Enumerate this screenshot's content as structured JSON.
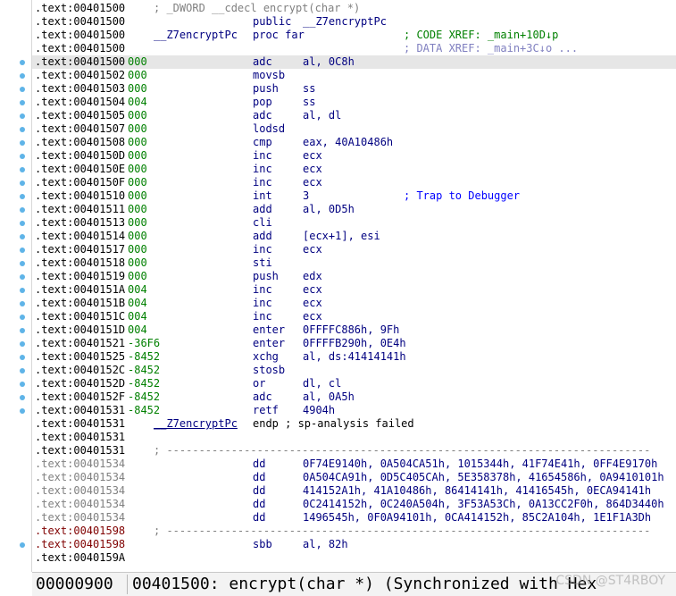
{
  "listing": {
    "rows": [
      {
        "addr": ".text:00401500",
        "topcmt": "; _DWORD __cdecl encrypt(char *)"
      },
      {
        "addr": ".text:00401500",
        "mnem": "public",
        "ops": "__Z7encryptPc"
      },
      {
        "addr": ".text:00401500",
        "label": "__Z7encryptPc",
        "mnem": "proc far",
        "xref1": "; CODE XREF: _main+10D↓p"
      },
      {
        "addr": ".text:00401500",
        "xref2": "; DATA XREF: _main+3C↓o ..."
      },
      {
        "addr": ".text:00401500",
        "sp": "000",
        "mnem": "adc",
        "ops": "al, 0C8h",
        "current": true
      },
      {
        "addr": ".text:00401502",
        "sp": "000",
        "mnem": "movsb"
      },
      {
        "addr": ".text:00401503",
        "sp": "000",
        "mnem": "push",
        "ops": "ss"
      },
      {
        "addr": ".text:00401504",
        "sp": "004",
        "mnem": "pop",
        "ops": "ss"
      },
      {
        "addr": ".text:00401505",
        "sp": "000",
        "mnem": "adc",
        "ops": "al, dl"
      },
      {
        "addr": ".text:00401507",
        "sp": "000",
        "mnem": "lodsd"
      },
      {
        "addr": ".text:00401508",
        "sp": "000",
        "mnem": "cmp",
        "ops": "eax, 40A10486h"
      },
      {
        "addr": ".text:0040150D",
        "sp": "000",
        "mnem": "inc",
        "ops": "ecx"
      },
      {
        "addr": ".text:0040150E",
        "sp": "000",
        "mnem": "inc",
        "ops": "ecx"
      },
      {
        "addr": ".text:0040150F",
        "sp": "000",
        "mnem": "inc",
        "ops": "ecx"
      },
      {
        "addr": ".text:00401510",
        "sp": "000",
        "mnem": "int",
        "ops": "3",
        "cmt": "; Trap to Debugger"
      },
      {
        "addr": ".text:00401511",
        "sp": "000",
        "mnem": "add",
        "ops": "al, 0D5h"
      },
      {
        "addr": ".text:00401513",
        "sp": "000",
        "mnem": "cli"
      },
      {
        "addr": ".text:00401514",
        "sp": "000",
        "mnem": "add",
        "ops": "[ecx+1], esi"
      },
      {
        "addr": ".text:00401517",
        "sp": "000",
        "mnem": "inc",
        "ops": "ecx"
      },
      {
        "addr": ".text:00401518",
        "sp": "000",
        "mnem": "sti"
      },
      {
        "addr": ".text:00401519",
        "sp": "000",
        "mnem": "push",
        "ops": "edx"
      },
      {
        "addr": ".text:0040151A",
        "sp": "004",
        "mnem": "inc",
        "ops": "ecx"
      },
      {
        "addr": ".text:0040151B",
        "sp": "004",
        "mnem": "inc",
        "ops": "ecx"
      },
      {
        "addr": ".text:0040151C",
        "sp": "004",
        "mnem": "inc",
        "ops": "ecx"
      },
      {
        "addr": ".text:0040151D",
        "sp": "004",
        "mnem": "enter",
        "ops": "0FFFFC886h, 9Fh"
      },
      {
        "addr": ".text:00401521",
        "sp": "-36F6",
        "mnem": "enter",
        "ops": "0FFFFB290h, 0E4h"
      },
      {
        "addr": ".text:00401525",
        "sp": "-8452",
        "mnem": "xchg",
        "ops": "al, ds:41414141h"
      },
      {
        "addr": ".text:0040152C",
        "sp": "-8452",
        "mnem": "stosb"
      },
      {
        "addr": ".text:0040152D",
        "sp": "-8452",
        "mnem": "or",
        "ops": "dl, cl"
      },
      {
        "addr": ".text:0040152F",
        "sp": "-8452",
        "mnem": "adc",
        "ops": "al, 0A5h"
      },
      {
        "addr": ".text:00401531",
        "sp": "-8452",
        "mnem": "retf",
        "ops": "4904h"
      },
      {
        "addr": ".text:00401531",
        "endp_label": "__Z7encryptPc",
        "endp_rest": "endp ; sp-analysis failed"
      },
      {
        "addr": ".text:00401531"
      },
      {
        "addr": ".text:00401531",
        "sep": "; ---------------------------------------------------------------------------"
      },
      {
        "addr": ".text:00401534",
        "addr_style": "data",
        "mnem": "dd",
        "ops": "0F74E9140h, 0A504CA51h, 1015344h, 41F74E41h, 0FF4E9170h"
      },
      {
        "addr": ".text:00401534",
        "addr_style": "data",
        "mnem": "dd",
        "ops": "0A504CA91h, 0D5C405CAh, 5E358378h, 41654586h, 0A9410101h"
      },
      {
        "addr": ".text:00401534",
        "addr_style": "data",
        "mnem": "dd",
        "ops": "414152A1h, 41A10486h, 86414141h, 41416545h, 0ECA94141h"
      },
      {
        "addr": ".text:00401534",
        "addr_style": "data",
        "mnem": "dd",
        "ops": "0C2414152h, 0C240A504h, 3F53A53Ch, 0A13CC2F0h, 864D3440h"
      },
      {
        "addr": ".text:00401534",
        "addr_style": "data",
        "mnem": "dd",
        "ops": "1496545h, 0F0A94101h, 0CA414152h, 85C2A104h, 1E1F1A3Dh"
      },
      {
        "addr": ".text:00401598",
        "addr_style": "red",
        "sep": "; ---------------------------------------------------------------------------"
      },
      {
        "addr": ".text:00401598",
        "addr_style": "red",
        "mnem": "sbb",
        "ops": "al, 82h"
      },
      {
        "addr": ".text:0040159A"
      }
    ],
    "dot_rows": [
      4,
      5,
      6,
      7,
      8,
      9,
      10,
      11,
      12,
      13,
      14,
      15,
      16,
      17,
      18,
      19,
      20,
      21,
      22,
      23,
      24,
      25,
      26,
      27,
      28,
      29,
      30,
      40
    ]
  },
  "status": {
    "offset": "00000900",
    "location": "00401500: encrypt(char *) (Synchronized with Hex",
    "watermark": "CSDN @ST4RBOY"
  }
}
